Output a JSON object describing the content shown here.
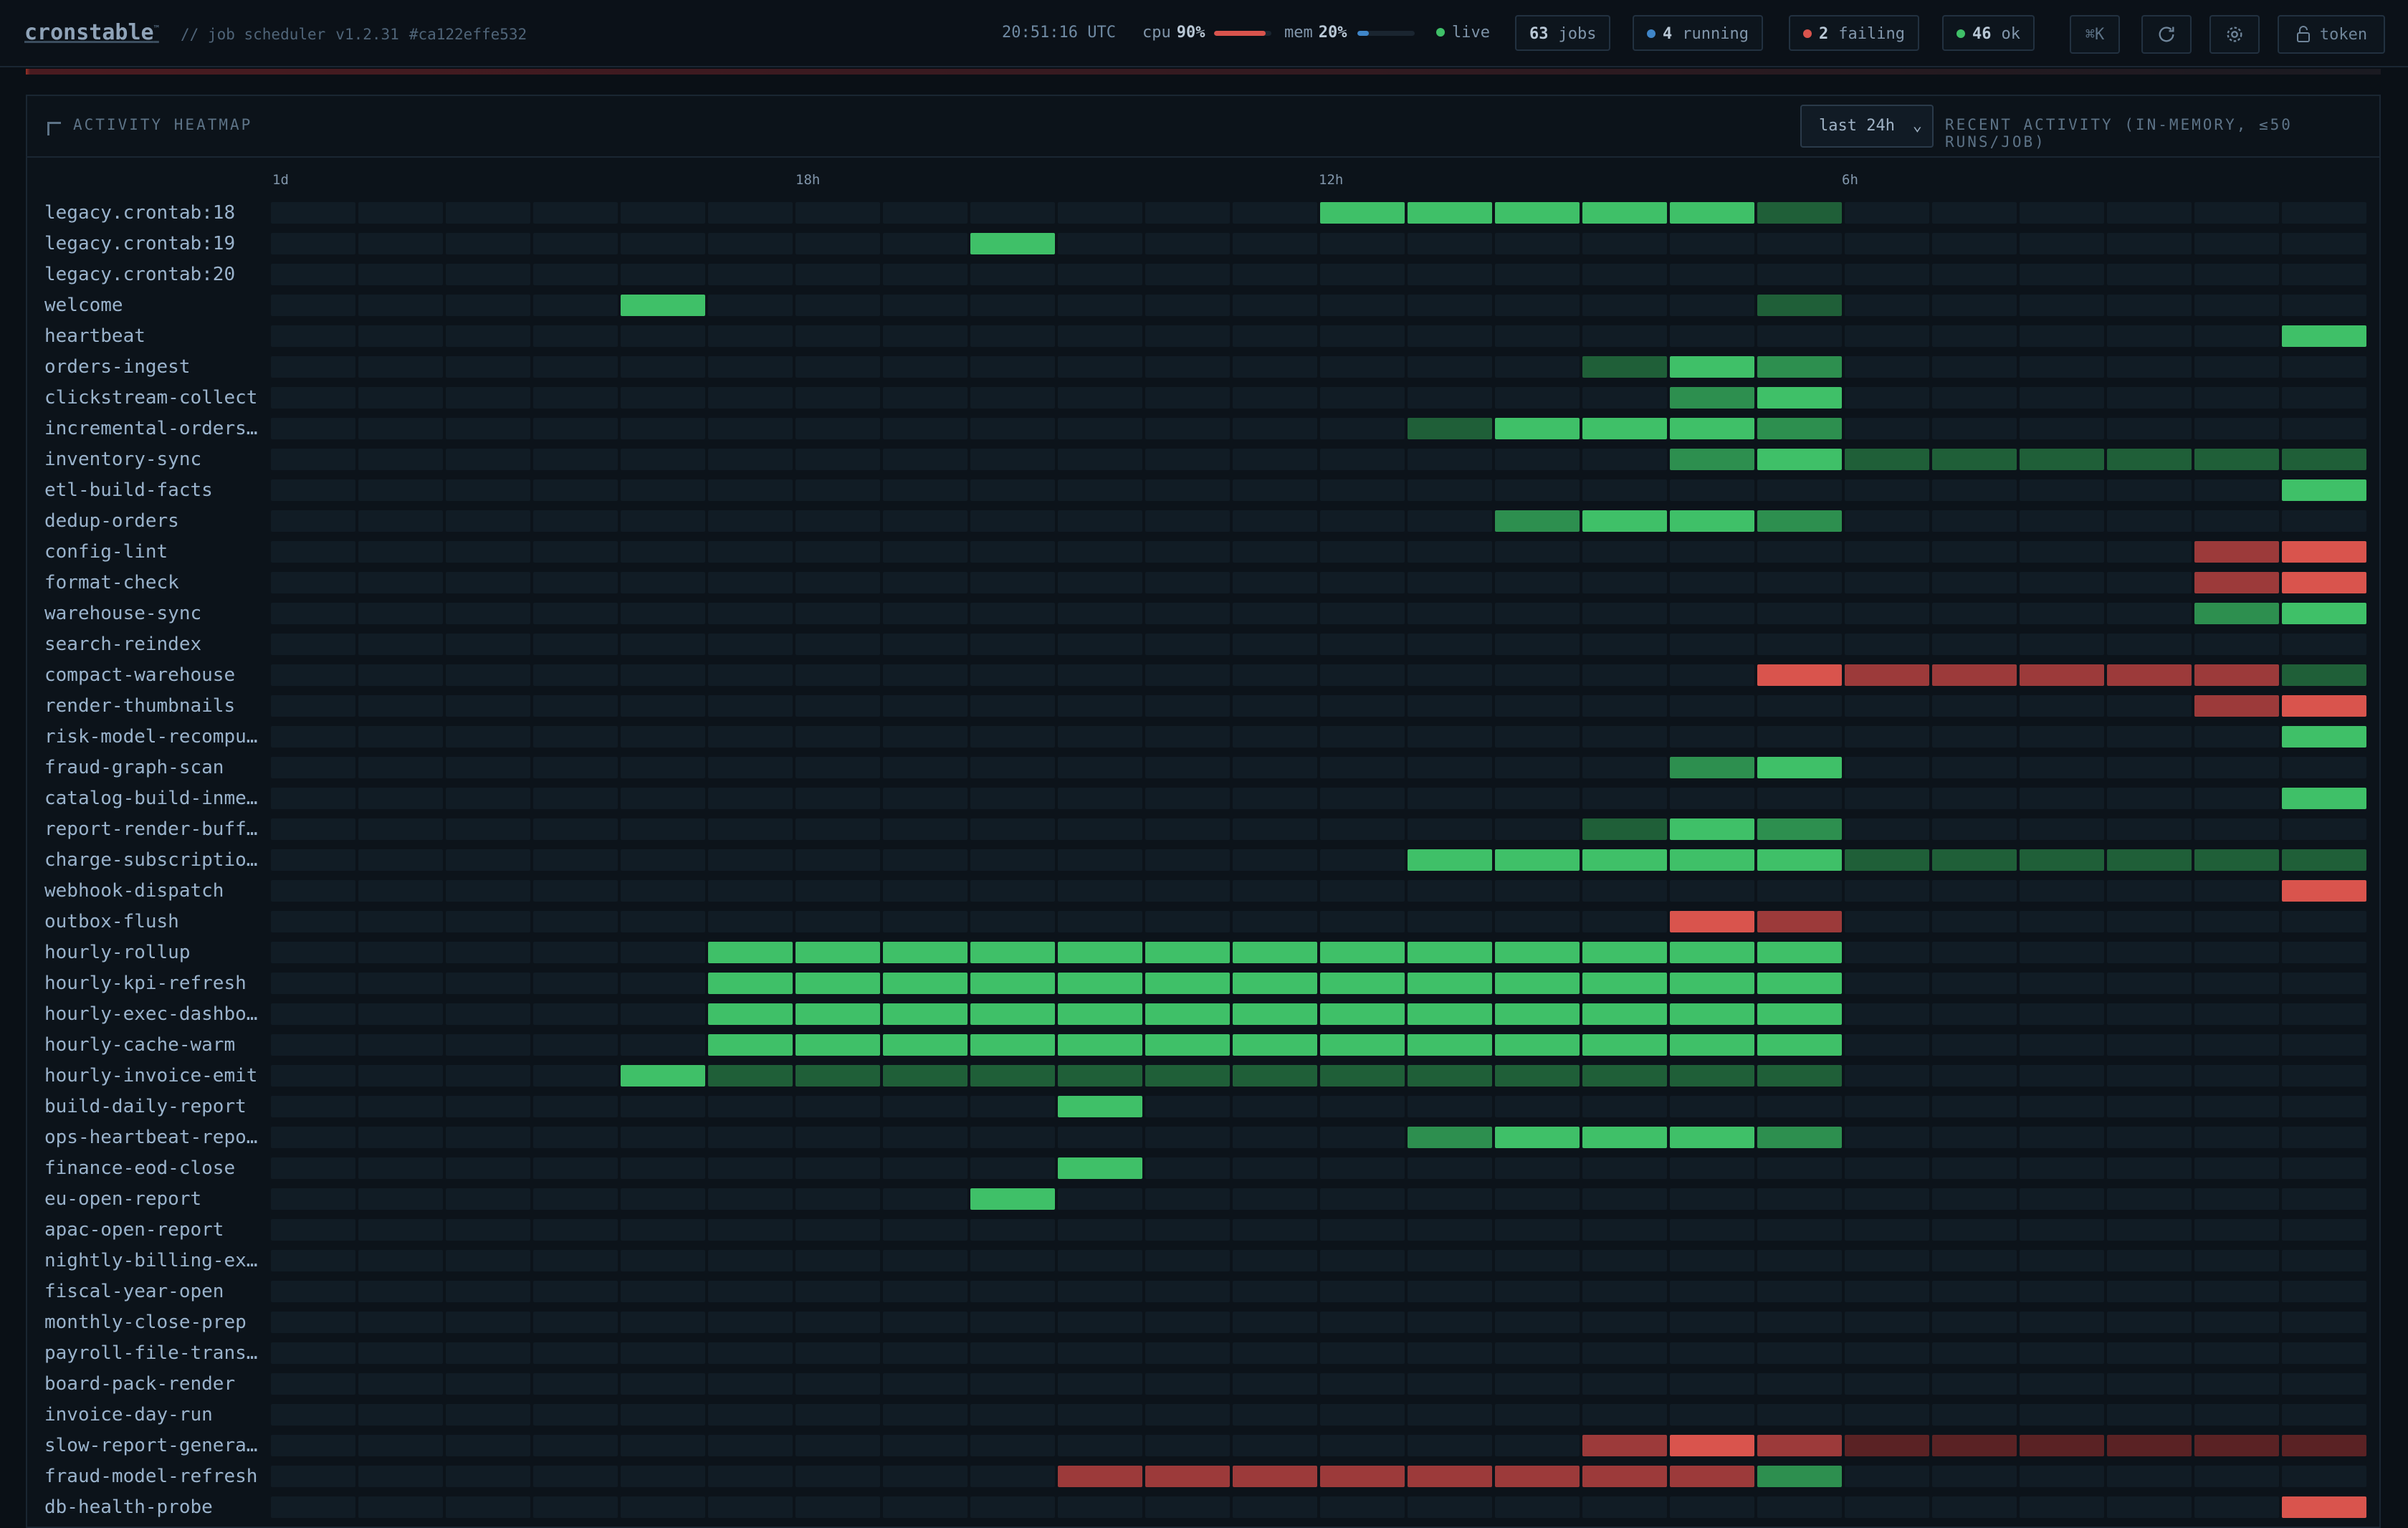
{
  "header": {
    "brand": "cronstable",
    "brand_mark": "™",
    "subtitle": "// job scheduler",
    "version": "v1.2.31",
    "commit": "#ca122effe532",
    "clock": "20:51:16 UTC",
    "cpu_label": "cpu",
    "cpu_value": "90%",
    "cpu_fraction": 0.9,
    "mem_label": "mem",
    "mem_value": "20%",
    "mem_fraction": 0.2,
    "live_label": "live",
    "jobs_count": "63",
    "jobs_label": "jobs",
    "running_count": "4",
    "running_label": "running",
    "failing_count": "2",
    "failing_label": "failing",
    "ok_count": "46",
    "ok_label": "ok",
    "shortcut_label": "⌘K",
    "token_label": "token",
    "icons": [
      "refresh-icon",
      "gear-icon",
      "lock-icon"
    ]
  },
  "heatmap": {
    "title": "ACTIVITY HEATMAP",
    "range_selected": "last 24h",
    "recent_label": "RECENT ACTIVITY (IN-MEMORY, ≤50 RUNS/JOB)",
    "time_ticks": [
      "1d",
      "18h",
      "12h",
      "6h"
    ],
    "legend_levels": {
      "0": "none",
      "1": "ok-low",
      "2": "ok-mid",
      "3": "ok-high",
      "4": "fail-low",
      "5": "fail-mid",
      "6": "fail-high"
    },
    "colors": {
      "ok_high": "#3fc068",
      "ok_mid": "#2d8f4f",
      "ok_low": "#1f5f38",
      "fail_high": "#d9544d",
      "fail_mid": "#9c3a3a",
      "fail_low": "#5a2224",
      "empty": "#111c25"
    },
    "jobs": [
      {
        "name": "legacy.crontab:18",
        "cells": "000000000000333331000000"
      },
      {
        "name": "legacy.crontab:19",
        "cells": "000000003000000000000000"
      },
      {
        "name": "legacy.crontab:20",
        "cells": "000000000000000000000000"
      },
      {
        "name": "welcome",
        "cells": "000030000000000001000000"
      },
      {
        "name": "heartbeat",
        "cells": "000000000000000000000003"
      },
      {
        "name": "orders-ingest",
        "cells": "000000000000000132000000"
      },
      {
        "name": "clickstream-collect",
        "cells": "000000000000000023000000"
      },
      {
        "name": "incremental-orders…",
        "cells": "000000000000013332000000"
      },
      {
        "name": "inventory-sync",
        "cells": "000000000000000023111111"
      },
      {
        "name": "etl-build-facts",
        "cells": "000000000000000000000003"
      },
      {
        "name": "dedup-orders",
        "cells": "000000000000002332000000"
      },
      {
        "name": "config-lint",
        "cells": "000000000000000000000056"
      },
      {
        "name": "format-check",
        "cells": "000000000000000000000056"
      },
      {
        "name": "warehouse-sync",
        "cells": "000000000000000000000023"
      },
      {
        "name": "search-reindex",
        "cells": "000000000000000000000000"
      },
      {
        "name": "compact-warehouse",
        "cells": "000000000000000006555551"
      },
      {
        "name": "render-thumbnails",
        "cells": "000000000000000000000056"
      },
      {
        "name": "risk-model-recompu…",
        "cells": "000000000000000000000003"
      },
      {
        "name": "fraud-graph-scan",
        "cells": "000000000000000023000000"
      },
      {
        "name": "catalog-build-inme…",
        "cells": "000000000000000000000003"
      },
      {
        "name": "report-render-buff…",
        "cells": "000000000000000132000000"
      },
      {
        "name": "charge-subscriptio…",
        "cells": "000000000000033333111111"
      },
      {
        "name": "webhook-dispatch",
        "cells": "000000000000000000000006"
      },
      {
        "name": "outbox-flush",
        "cells": "000000000000000065000000"
      },
      {
        "name": "hourly-rollup",
        "cells": "000003333333333333000000"
      },
      {
        "name": "hourly-kpi-refresh",
        "cells": "000003333333333333000000"
      },
      {
        "name": "hourly-exec-dashbo…",
        "cells": "000003333333333333000000"
      },
      {
        "name": "hourly-cache-warm",
        "cells": "000003333333333333000000"
      },
      {
        "name": "hourly-invoice-emit",
        "cells": "000031111111111111000000"
      },
      {
        "name": "build-daily-report",
        "cells": "000000000300000000000000"
      },
      {
        "name": "ops-heartbeat-repo…",
        "cells": "000000000000023332000000"
      },
      {
        "name": "finance-eod-close",
        "cells": "000000000300000000000000"
      },
      {
        "name": "eu-open-report",
        "cells": "000000003000000000000000"
      },
      {
        "name": "apac-open-report",
        "cells": "000000000000000000000000"
      },
      {
        "name": "nightly-billing-ex…",
        "cells": "000000000000000000000000"
      },
      {
        "name": "fiscal-year-open",
        "cells": "000000000000000000000000"
      },
      {
        "name": "monthly-close-prep",
        "cells": "000000000000000000000000"
      },
      {
        "name": "payroll-file-trans…",
        "cells": "000000000000000000000000"
      },
      {
        "name": "board-pack-render",
        "cells": "000000000000000000000000"
      },
      {
        "name": "invoice-day-run",
        "cells": "000000000000000000000000"
      },
      {
        "name": "slow-report-genera…",
        "cells": "000000000000000565444444"
      },
      {
        "name": "fraud-model-refresh",
        "cells": "000000000555555552000000"
      },
      {
        "name": "db-health-probe",
        "cells": "000000000000000000000006"
      }
    ]
  }
}
